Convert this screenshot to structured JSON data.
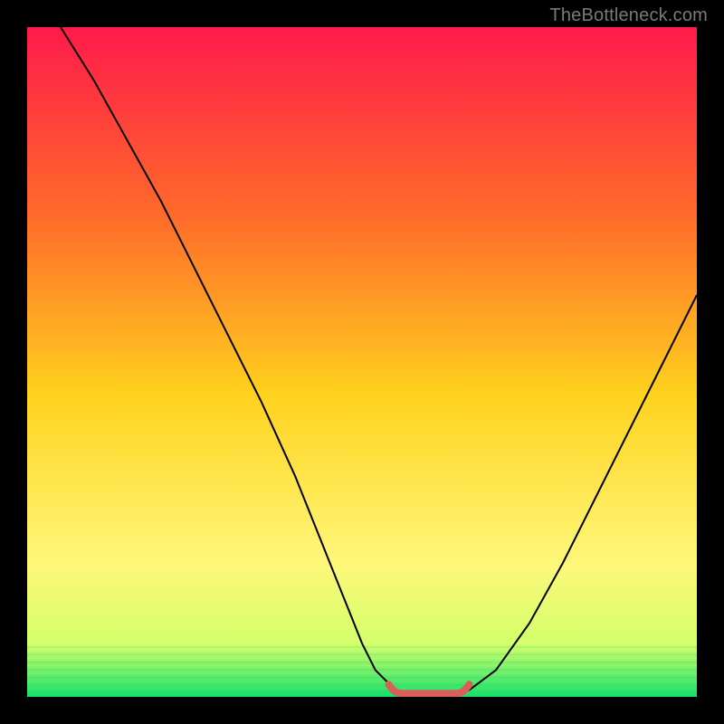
{
  "watermark": "TheBottleneck.com",
  "colors": {
    "gradient_top": "#ff1a4b",
    "gradient_upper": "#ff6a2a",
    "gradient_mid": "#ffd21e",
    "gradient_lower": "#fff77a",
    "gradient_bottom": "#17e06a",
    "curve": "#000000",
    "valley_marker": "#d9605a",
    "frame": "#000000"
  },
  "chart_data": {
    "type": "line",
    "title": "",
    "xlabel": "",
    "ylabel": "",
    "x_range": [
      0,
      100
    ],
    "y_range": [
      0,
      100
    ],
    "series": [
      {
        "name": "curve",
        "x": [
          5,
          10,
          15,
          20,
          25,
          30,
          35,
          40,
          44,
          48,
          50,
          52,
          55,
          60,
          62,
          66,
          70,
          75,
          80,
          85,
          90,
          95,
          100
        ],
        "y": [
          100,
          92,
          83,
          74,
          64,
          54,
          44,
          33,
          23,
          13,
          8,
          4,
          1,
          0,
          0,
          1,
          4,
          11,
          20,
          30,
          40,
          50,
          60
        ]
      }
    ],
    "valley_marker": {
      "x_start": 54,
      "x_end": 66,
      "y": 0.5,
      "thickness": 4
    },
    "background": {
      "type": "vertical-gradient",
      "stops": [
        {
          "pos": 0.0,
          "color": "#ff1a4b"
        },
        {
          "pos": 0.28,
          "color": "#ff6a2a"
        },
        {
          "pos": 0.55,
          "color": "#ffd21e"
        },
        {
          "pos": 0.8,
          "color": "#fff77a"
        },
        {
          "pos": 0.92,
          "color": "#d3ff6a"
        },
        {
          "pos": 1.0,
          "color": "#17e06a"
        }
      ]
    }
  }
}
